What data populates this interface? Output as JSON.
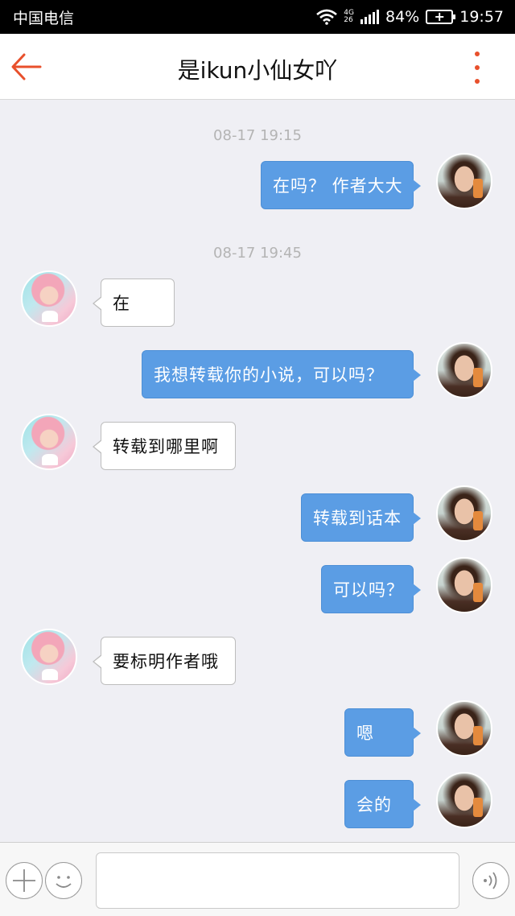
{
  "status_bar": {
    "carrier": "中国电信",
    "network_top": "4G",
    "network_bottom": "26",
    "battery": "84%",
    "time": "19:57",
    "icons": [
      "wifi-icon",
      "signal-icon",
      "battery-charging-icon"
    ]
  },
  "header": {
    "title": "是ikun小仙女吖",
    "back_icon": "arrow-left-icon",
    "menu_icon": "more-vertical-icon",
    "accent_color": "#e8502c"
  },
  "colors": {
    "outgoing_bubble": "#5b9de4",
    "incoming_bubble": "#ffffff",
    "background": "#efeff4",
    "timestamp": "#b4b4b4"
  },
  "messages": {
    "ts1": "08-17 19:15",
    "m1": "在吗？ 作者大大",
    "ts2": "08-17 19:45",
    "m2": "在",
    "m3": "我想转载你的小说，可以吗？",
    "m4": "转载到哪里啊",
    "m5": "转载到话本",
    "m6": "可以吗？",
    "m7": "要标明作者哦",
    "m8": "嗯",
    "m9": "会的"
  },
  "input_bar": {
    "message_value": "",
    "message_placeholder": "",
    "icons": [
      "plus-icon",
      "emoji-icon",
      "voice-icon"
    ]
  }
}
